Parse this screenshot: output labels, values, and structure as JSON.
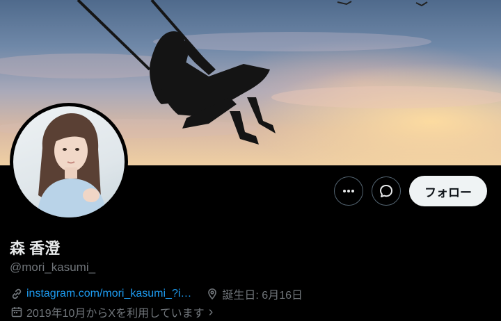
{
  "profile": {
    "display_name": "森 香澄",
    "handle": "@mori_kasumi_",
    "link_text": "instagram.com/mori_kasumi_?i…",
    "birthday": "誕生日: 6月16日",
    "joined": "2019年10月からXを利用しています",
    "joined_chevron": "›"
  },
  "actions": {
    "more_icon": "more-dots-icon",
    "message_icon": "message-bubble-icon",
    "follow_label": "フォロー"
  },
  "icons": {
    "link": "link-icon",
    "location": "location-pin-icon",
    "calendar": "calendar-icon"
  },
  "colors": {
    "accent": "#1d9bf0",
    "secondary_text": "#71767b",
    "primary_text": "#e7e9ea",
    "background": "#000000"
  }
}
